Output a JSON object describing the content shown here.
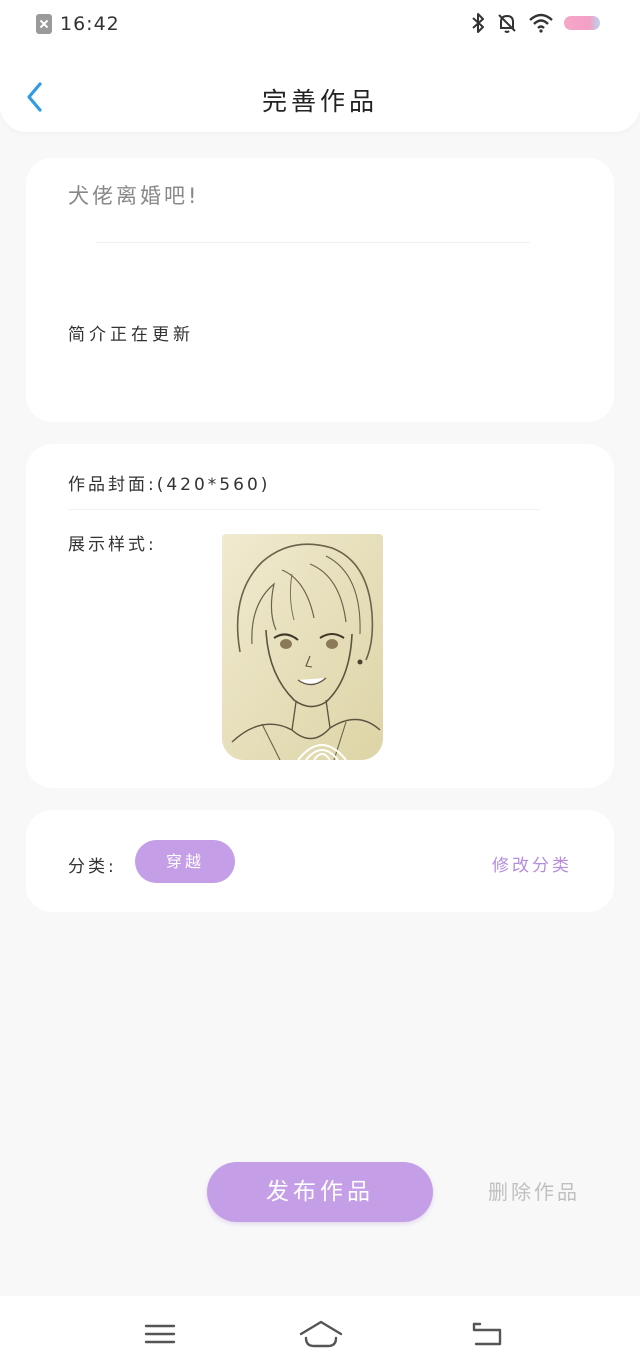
{
  "status_bar": {
    "time": "16:42",
    "icons": [
      "notification-close-icon",
      "bluetooth-icon",
      "mute-bell-icon",
      "wifi-icon",
      "battery-icon"
    ],
    "battery_color": "#f2a1c4"
  },
  "header": {
    "title": "完善作品",
    "back_icon": "chevron-left-icon",
    "accent_color": "#2f9be4"
  },
  "work": {
    "title": "犬佬离婚吧!",
    "intro": "简介正在更新"
  },
  "cover": {
    "label": "作品封面:(420*560)",
    "style_label": "展示样式:"
  },
  "category": {
    "label": "分类:",
    "tag": "穿越",
    "edit_label": "修改分类",
    "tag_color": "#c49ee6"
  },
  "actions": {
    "publish_label": "发布作品",
    "delete_label": "删除作品"
  },
  "nav_bar": {
    "icons": [
      "menu-icon",
      "home-icon",
      "back-icon"
    ]
  }
}
